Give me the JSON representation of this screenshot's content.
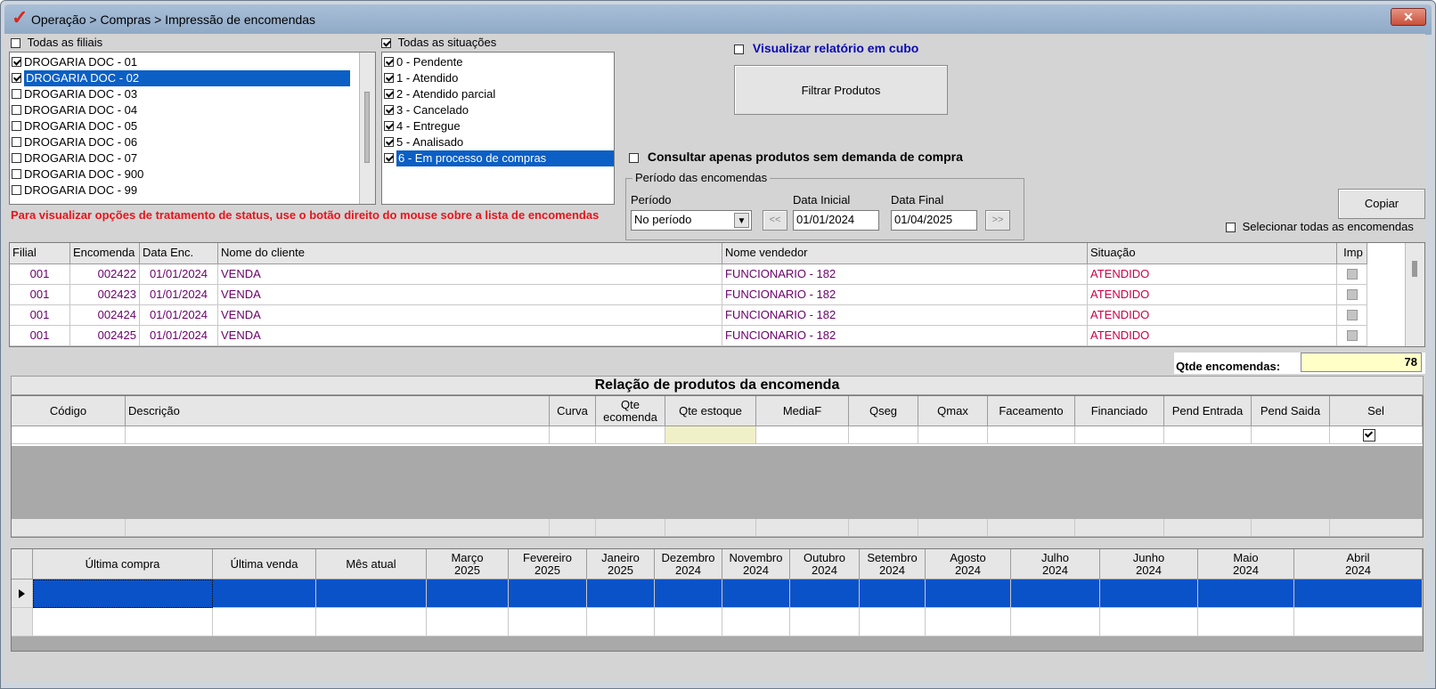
{
  "window": {
    "title": "Operação > Compras > Impressão de encomendas",
    "close_label": "✕"
  },
  "branches": {
    "all_label": "Todas as filiais",
    "all_checked": false,
    "items": [
      {
        "label": "DROGARIA DOC - 01",
        "checked": true,
        "selected": false
      },
      {
        "label": "DROGARIA DOC - 02",
        "checked": true,
        "selected": true
      },
      {
        "label": "DROGARIA DOC - 03",
        "checked": false,
        "selected": false
      },
      {
        "label": "DROGARIA DOC - 04",
        "checked": false,
        "selected": false
      },
      {
        "label": "DROGARIA DOC - 05",
        "checked": false,
        "selected": false
      },
      {
        "label": "DROGARIA DOC - 06",
        "checked": false,
        "selected": false
      },
      {
        "label": "DROGARIA DOC - 07",
        "checked": false,
        "selected": false
      },
      {
        "label": "DROGARIA DOC - 900",
        "checked": false,
        "selected": false
      },
      {
        "label": "DROGARIA DOC - 99",
        "checked": false,
        "selected": false
      }
    ]
  },
  "situations": {
    "all_label": "Todas as situações",
    "all_checked": true,
    "items": [
      {
        "label": "0 - Pendente",
        "checked": true,
        "selected": false
      },
      {
        "label": "1 - Atendido",
        "checked": true,
        "selected": false
      },
      {
        "label": "2 - Atendido parcial",
        "checked": true,
        "selected": false
      },
      {
        "label": "3 - Cancelado",
        "checked": true,
        "selected": false
      },
      {
        "label": "4 - Entregue",
        "checked": true,
        "selected": false
      },
      {
        "label": "5 - Analisado",
        "checked": true,
        "selected": false
      },
      {
        "label": "6 - Em processo de compras",
        "checked": true,
        "selected": true
      }
    ]
  },
  "options": {
    "cube_report_label": "Visualizar relatório em cubo",
    "filter_products_label": "Filtrar Produtos",
    "no_demand_label": "Consultar apenas produtos sem demanda de compra",
    "copy_label": "Copiar",
    "select_all_orders_label": "Selecionar todas as encomendas"
  },
  "period": {
    "group_label": "Período das encomendas",
    "period_label": "Período",
    "period_value": "No período",
    "start_label": "Data Inicial",
    "start_value": "01/01/2024",
    "end_label": "Data Final",
    "end_value": "01/04/2025",
    "prev_label": "<<",
    "next_label": ">>"
  },
  "hint": {
    "text": "Para visualizar opções de tratamento de status, use o botão direito do mouse sobre a lista de encomendas",
    "color": "#e8141b"
  },
  "orders": {
    "columns": [
      "Filial",
      "Encomenda",
      "Data Enc.",
      "Nome do cliente",
      "Nome vendedor",
      "Situação",
      "Imp"
    ],
    "rows": [
      [
        "001",
        "002422",
        "01/01/2024",
        "VENDA",
        "FUNCIONARIO - 182",
        "ATENDIDO"
      ],
      [
        "001",
        "002423",
        "01/01/2024",
        "VENDA",
        "FUNCIONARIO - 182",
        "ATENDIDO"
      ],
      [
        "001",
        "002424",
        "01/01/2024",
        "VENDA",
        "FUNCIONARIO - 182",
        "ATENDIDO"
      ],
      [
        "001",
        "002425",
        "01/01/2024",
        "VENDA",
        "FUNCIONARIO - 182",
        "ATENDIDO"
      ]
    ],
    "count_label": "Qtde encomendas:",
    "count_value": "78"
  },
  "products": {
    "title": "Relação de produtos da encomenda",
    "columns": [
      "Código",
      "Descrição",
      "Curva",
      "Qte ecomenda",
      "Qte estoque",
      "MediaF",
      "Qseg",
      "Qmax",
      "Faceamento",
      "Financiado",
      "Pend Entrada",
      "Pend Saida",
      "Sel"
    ],
    "sel_checked": true
  },
  "history": {
    "columns": [
      {
        "l1": "Última compra",
        "l2": ""
      },
      {
        "l1": "Última venda",
        "l2": ""
      },
      {
        "l1": "Mês atual",
        "l2": ""
      },
      {
        "l1": "Março",
        "l2": "2025"
      },
      {
        "l1": "Fevereiro",
        "l2": "2025"
      },
      {
        "l1": "Janeiro",
        "l2": "2025"
      },
      {
        "l1": "Dezembro",
        "l2": "2024"
      },
      {
        "l1": "Novembro",
        "l2": "2024"
      },
      {
        "l1": "Outubro",
        "l2": "2024"
      },
      {
        "l1": "Setembro",
        "l2": "2024"
      },
      {
        "l1": "Agosto",
        "l2": "2024"
      },
      {
        "l1": "Julho",
        "l2": "2024"
      },
      {
        "l1": "Junho",
        "l2": "2024"
      },
      {
        "l1": "Maio",
        "l2": "2024"
      },
      {
        "l1": "Abril",
        "l2": "2024"
      }
    ],
    "selected_color": "#0a52c8"
  }
}
